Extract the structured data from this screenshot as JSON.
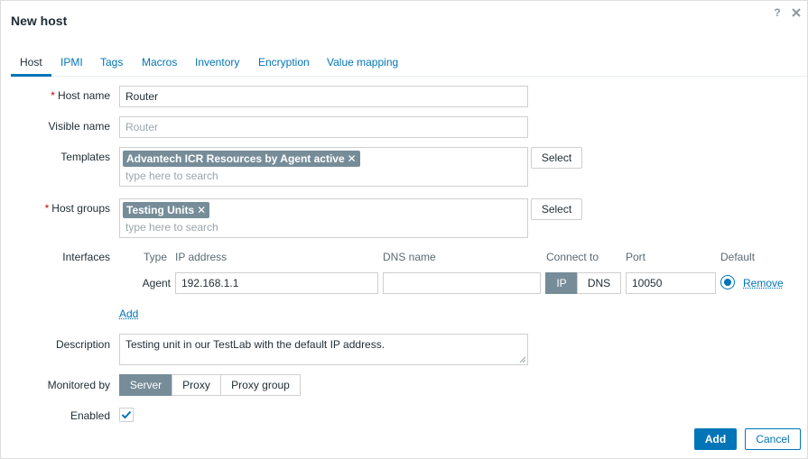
{
  "dialog": {
    "title": "New host",
    "help_icon": "help-icon",
    "close_icon": "close-icon"
  },
  "tabs": [
    {
      "label": "Host",
      "active": true
    },
    {
      "label": "IPMI"
    },
    {
      "label": "Tags"
    },
    {
      "label": "Macros"
    },
    {
      "label": "Inventory"
    },
    {
      "label": "Encryption"
    },
    {
      "label": "Value mapping"
    }
  ],
  "form": {
    "required_mark": "*",
    "host_name": {
      "label": "Host name",
      "value": "Router"
    },
    "visible_name": {
      "label": "Visible name",
      "value": "",
      "placeholder": "Router"
    },
    "templates": {
      "label": "Templates",
      "chips": [
        {
          "label": "Advantech ICR Resources by Agent active",
          "remove": "✕"
        }
      ],
      "search_placeholder": "type here to search",
      "select_label": "Select"
    },
    "host_groups": {
      "label": "Host groups",
      "chips": [
        {
          "label": "Testing Units",
          "remove": "✕"
        }
      ],
      "search_placeholder": "type here to search",
      "select_label": "Select"
    },
    "interfaces": {
      "label": "Interfaces",
      "headers": {
        "type": "Type",
        "ip": "IP address",
        "dns": "DNS name",
        "connect": "Connect to",
        "port": "Port",
        "default": "Default"
      },
      "rows": [
        {
          "type": "Agent",
          "ip": "192.168.1.1",
          "dns": "",
          "connect_options": [
            "IP",
            "DNS"
          ],
          "connect_selected": "IP",
          "port": "10050",
          "default": true,
          "remove_label": "Remove"
        }
      ],
      "add_label": "Add"
    },
    "description": {
      "label": "Description",
      "value": "Testing unit in our TestLab with the default IP address."
    },
    "monitored_by": {
      "label": "Monitored by",
      "options": [
        "Server",
        "Proxy",
        "Proxy group"
      ],
      "selected": "Server"
    },
    "enabled": {
      "label": "Enabled",
      "checked": true
    }
  },
  "footer": {
    "add_label": "Add",
    "cancel_label": "Cancel"
  },
  "colors": {
    "accent": "#0275b8",
    "chip": "#768d99",
    "required": "#d40000"
  }
}
